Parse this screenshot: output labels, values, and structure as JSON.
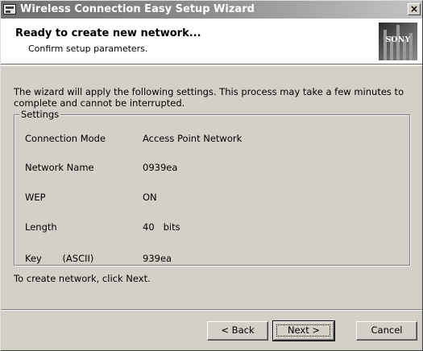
{
  "window": {
    "title": "Wireless Connection Easy Setup Wizard",
    "close_symbol": "×"
  },
  "header": {
    "title": "Ready to create new network...",
    "subtitle": "Confirm setup parameters.",
    "logo_text": "SONY"
  },
  "body": {
    "intro": "The wizard will apply the following settings. This process may take a few minutes to complete and cannot be interrupted.",
    "settings": {
      "group_label": "Settings",
      "rows": [
        {
          "label": "Connection Mode",
          "value": "Access Point Network"
        },
        {
          "label": "Network Name",
          "value": "0939ea"
        },
        {
          "label": "WEP",
          "value": "ON"
        },
        {
          "label": "Length",
          "value": "40   bits"
        },
        {
          "label": "Key       (ASCII)",
          "value": "939ea"
        }
      ]
    },
    "footer_note": "To create network, click Next."
  },
  "buttons": {
    "back": "< Back",
    "next": "Next >",
    "cancel": "Cancel"
  },
  "icons": {
    "app": "wizard-app-icon",
    "close": "close-icon",
    "logo": "sony-logo"
  }
}
